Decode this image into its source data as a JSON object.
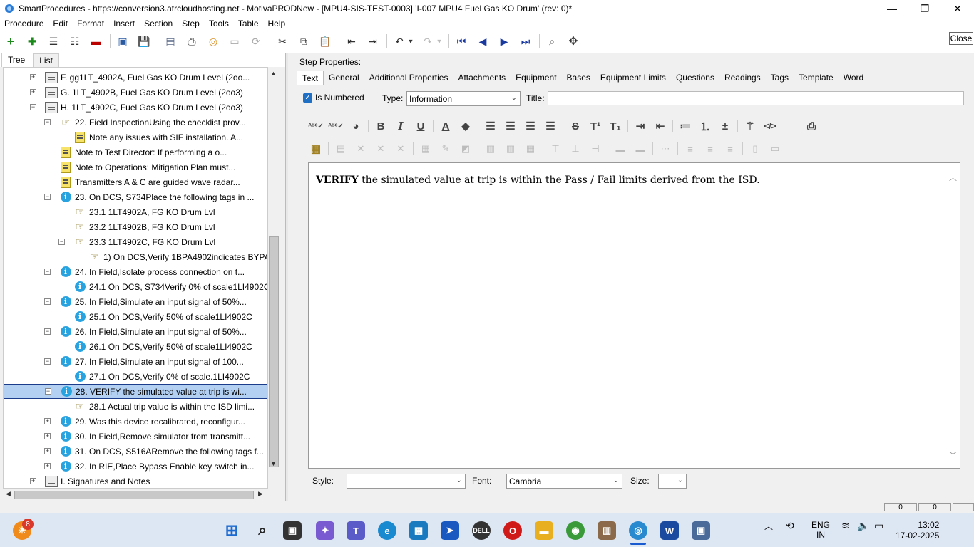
{
  "window": {
    "title": "SmartProcedures - https://conversion3.atrcloudhosting.net - MotivaPRODNew - [MPU4-SIS-TEST-0003] 'I-007 MPU4 Fuel Gas KO Drum' (rev: 0)*",
    "minimize": "—",
    "maximize": "❐",
    "close": "✕"
  },
  "menu": [
    {
      "label": "Procedure"
    },
    {
      "label": "Edit"
    },
    {
      "label": "Format"
    },
    {
      "label": "Insert"
    },
    {
      "label": "Section"
    },
    {
      "label": "Step"
    },
    {
      "label": "Tools"
    },
    {
      "label": "Table"
    },
    {
      "label": "Help"
    }
  ],
  "close_button": "Close",
  "left_tabs": {
    "tree": "Tree",
    "list": "List"
  },
  "tree": [
    {
      "text": "F. gg1LT_4902A, Fuel Gas KO Drum Level (2oo...",
      "icon": "doc",
      "exp": "+",
      "indent": 0
    },
    {
      "text": "G. 1LT_4902B, Fuel Gas KO Drum Level (2oo3)",
      "icon": "doc",
      "exp": "+",
      "indent": 0
    },
    {
      "text": "H. 1LT_4902C, Fuel Gas KO Drum Level (2oo3)",
      "icon": "doc",
      "exp": "−",
      "indent": 0
    },
    {
      "text": "22. Field InspectionUsing the checklist prov...",
      "icon": "hand",
      "exp": "−",
      "indent": 1
    },
    {
      "text": "Note any issues with SIF installation. A...",
      "icon": "note",
      "exp": "",
      "indent": 2
    },
    {
      "text": "Note to Test Director: If performing a o...",
      "icon": "note",
      "exp": "",
      "indent": 1
    },
    {
      "text": "Note to Operations: Mitigation Plan must...",
      "icon": "note",
      "exp": "",
      "indent": 1
    },
    {
      "text": "Transmitters A & C are guided wave radar...",
      "icon": "note",
      "exp": "",
      "indent": 1
    },
    {
      "text": "23. On DCS, S734Place the following tags in ...",
      "icon": "info",
      "exp": "−",
      "indent": 1
    },
    {
      "text": "23.1 1LT4902A, FG KO Drum Lvl",
      "icon": "hand",
      "exp": "",
      "indent": 2
    },
    {
      "text": "23.2 1LT4902B, FG KO Drum Lvl",
      "icon": "hand",
      "exp": "",
      "indent": 2
    },
    {
      "text": "23.3 1LT4902C, FG KO Drum Lvl",
      "icon": "hand",
      "exp": "−",
      "indent": 2
    },
    {
      "text": "1) On DCS,Verify 1BPA4902indicates BYPASS",
      "icon": "hand",
      "exp": "",
      "indent": 3
    },
    {
      "text": "24. In Field,Isolate process connection on t...",
      "icon": "info",
      "exp": "−",
      "indent": 1
    },
    {
      "text": "24.1 On DCS, S734Verify 0% of scale1LI4902C",
      "icon": "info",
      "exp": "",
      "indent": 2
    },
    {
      "text": "25. In Field,Simulate an input signal of 50%...",
      "icon": "info",
      "exp": "−",
      "indent": 1
    },
    {
      "text": "25.1 On DCS,Verify 50% of scale1LI4902C",
      "icon": "info",
      "exp": "",
      "indent": 2
    },
    {
      "text": "26. In Field,Simulate an input signal of 50%...",
      "icon": "info",
      "exp": "−",
      "indent": 1
    },
    {
      "text": "26.1 On DCS,Verify 50% of scale1LI4902C",
      "icon": "info",
      "exp": "",
      "indent": 2
    },
    {
      "text": "27. In Field,Simulate an input signal of 100...",
      "icon": "info",
      "exp": "−",
      "indent": 1
    },
    {
      "text": "27.1 On DCS,Verify 0% of scale.1LI4902C",
      "icon": "info",
      "exp": "",
      "indent": 2
    },
    {
      "text": "28. VERIFY the simulated value at trip is wi...",
      "icon": "info",
      "exp": "−",
      "indent": 1,
      "selected": true
    },
    {
      "text": "28.1 Actual trip value is within the ISD limi...",
      "icon": "hand",
      "exp": "",
      "indent": 2
    },
    {
      "text": "29. Was this device recalibrated, reconfigur...",
      "icon": "info",
      "exp": "+",
      "indent": 1
    },
    {
      "text": "30. In Field,Remove simulator from transmitt...",
      "icon": "info",
      "exp": "+",
      "indent": 1
    },
    {
      "text": "31. On DCS, S516ARemove the following tags f...",
      "icon": "info",
      "exp": "+",
      "indent": 1
    },
    {
      "text": "32. In RIE,Place Bypass Enable key switch in...",
      "icon": "info",
      "exp": "+",
      "indent": 1
    },
    {
      "text": "I. Signatures and Notes",
      "icon": "doc",
      "exp": "+",
      "indent": 0
    }
  ],
  "step_properties": {
    "heading": "Step Properties:",
    "tabs": [
      "Text",
      "General",
      "Additional Properties",
      "Attachments",
      "Equipment",
      "Bases",
      "Equipment Limits",
      "Questions",
      "Readings",
      "Tags",
      "Template",
      "Word"
    ],
    "is_numbered_label": "Is Numbered",
    "type_label": "Type:",
    "type_value": "Information",
    "title_label": "Title:",
    "title_value": "",
    "editor_bold": "VERIFY",
    "editor_rest": " the simulated value at trip is within the Pass / Fail limits derived from the ISD.",
    "style_label": "Style:",
    "style_value": "",
    "font_label": "Font:",
    "font_value": "Cambria",
    "size_label": "Size:",
    "size_value": "",
    "status_box_1": "0",
    "status_box_2": "0"
  },
  "taskbar": {
    "badge_count": "8",
    "lang_1": "ENG",
    "lang_2": "IN",
    "time": "13:02",
    "date": "17-02-2025"
  }
}
